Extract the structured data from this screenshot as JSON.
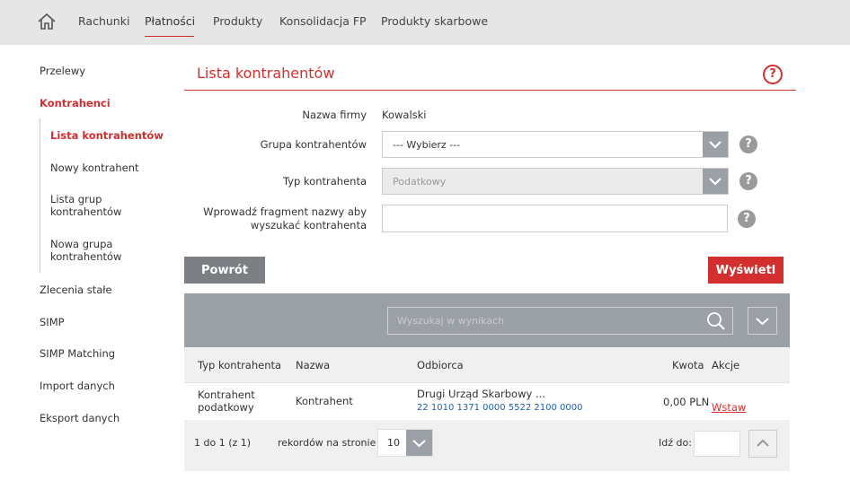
{
  "topnav": {
    "items": [
      {
        "label": "Rachunki"
      },
      {
        "label": "Płatności"
      },
      {
        "label": "Produkty"
      },
      {
        "label": "Konsolidacja FP"
      },
      {
        "label": "Produkty skarbowe"
      }
    ],
    "active": "Płatności"
  },
  "sidebar": {
    "items": [
      {
        "label": "Przelewy"
      },
      {
        "label": "Kontrahenci"
      },
      {
        "label": "Lista kontrahentów"
      },
      {
        "label": "Nowy kontrahent"
      },
      {
        "label": "Lista grup kontrahentów"
      },
      {
        "label": "Nowa grupa kontrahentów"
      },
      {
        "label": "Zlecenia stałe"
      },
      {
        "label": "SIMP"
      },
      {
        "label": "SIMP Matching"
      },
      {
        "label": "Import danych"
      },
      {
        "label": "Eksport danych"
      }
    ]
  },
  "page": {
    "title": "Lista kontrahentów",
    "help": "?"
  },
  "form": {
    "company_label": "Nazwa firmy",
    "company_value": "Kowalski",
    "group_label": "Grupa kontrahentów",
    "group_value": "--- Wybierz ---",
    "type_label": "Typ kontrahenta",
    "type_value": "Podatkowy",
    "search_label_1": "Wprowadź fragment nazwy aby",
    "search_label_2": "wyszukać kontrahenta",
    "help": "?"
  },
  "buttons": {
    "back": "Powrót",
    "show": "Wyświetl"
  },
  "grid": {
    "search_placeholder": "Wyszukaj w wynikach",
    "columns": [
      "Typ kontrahenta",
      "Nazwa",
      "Odbiorca",
      "Kwota",
      "Akcje"
    ],
    "rows": [
      {
        "type_1": "Kontrahent",
        "type_2": "podatkowy",
        "name": "Kontrahent",
        "recipient": "Drugi Urząd Skarbowy ...",
        "account": "22 1010 1371 0000 5522 2100 0000",
        "amount": "0,00 PLN",
        "action": "Wstaw"
      }
    ]
  },
  "pagination": {
    "range": "1 do 1 (z 1)",
    "per_page_label": "rekordów na stronie",
    "per_page_value": "10",
    "goto_label": "Idź do:"
  },
  "colors": {
    "accent": "#d32f2f",
    "grey_button": "#7b7f84",
    "grid_bar": "#9aa0a6",
    "account_link": "#1f5fa8"
  },
  "icons": [
    "home-icon",
    "help-icon",
    "chevron-down-icon",
    "search-icon",
    "chevron-up-icon"
  ]
}
